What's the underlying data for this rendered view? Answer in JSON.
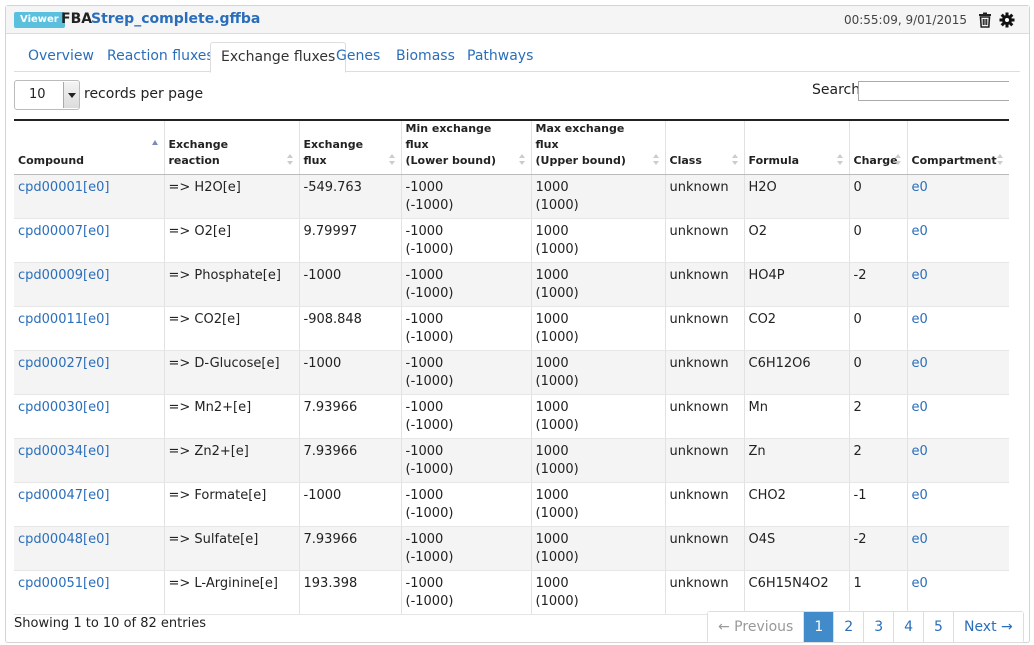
{
  "header": {
    "badge": "Viewer",
    "object_type": "FBA",
    "object_name": "Strep_complete.gffba",
    "timestamp": "00:55:09, 9/01/2015"
  },
  "icons": {
    "trash": "trash-icon",
    "settings": "gear-icon"
  },
  "tabs": [
    {
      "label": "Overview"
    },
    {
      "label": "Reaction fluxes"
    },
    {
      "label": "Exchange fluxes",
      "active": true
    },
    {
      "label": "Genes"
    },
    {
      "label": "Biomass"
    },
    {
      "label": "Pathways"
    }
  ],
  "length_select": {
    "value": "10",
    "label": "records per page"
  },
  "search": {
    "label": "Search:",
    "value": ""
  },
  "table": {
    "columns": [
      {
        "line1": "Compound",
        "line2": ""
      },
      {
        "line1": "Exchange reaction",
        "line2": ""
      },
      {
        "line1": "Exchange flux",
        "line2": ""
      },
      {
        "line1": "Min exchange flux",
        "line2": "(Lower bound)"
      },
      {
        "line1": "Max exchange flux",
        "line2": "(Upper bound)"
      },
      {
        "line1": "Class",
        "line2": ""
      },
      {
        "line1": "Formula",
        "line2": ""
      },
      {
        "line1": "Charge",
        "line2": ""
      },
      {
        "line1": "Compartment",
        "line2": ""
      }
    ],
    "rows": [
      {
        "compound": "cpd00001[e0]",
        "reaction": "=> H2O[e]",
        "flux": "-549.763",
        "min1": "-1000",
        "min2": "(-1000)",
        "max1": "1000",
        "max2": "(1000)",
        "class": "unknown",
        "formula": "H2O",
        "charge": "0",
        "compartment": "e0"
      },
      {
        "compound": "cpd00007[e0]",
        "reaction": "=> O2[e]",
        "flux": "9.79997",
        "min1": "-1000",
        "min2": "(-1000)",
        "max1": "1000",
        "max2": "(1000)",
        "class": "unknown",
        "formula": "O2",
        "charge": "0",
        "compartment": "e0"
      },
      {
        "compound": "cpd00009[e0]",
        "reaction": "=> Phosphate[e]",
        "flux": "-1000",
        "min1": "-1000",
        "min2": "(-1000)",
        "max1": "1000",
        "max2": "(1000)",
        "class": "unknown",
        "formula": "HO4P",
        "charge": "-2",
        "compartment": "e0"
      },
      {
        "compound": "cpd00011[e0]",
        "reaction": "=> CO2[e]",
        "flux": "-908.848",
        "min1": "-1000",
        "min2": "(-1000)",
        "max1": "1000",
        "max2": "(1000)",
        "class": "unknown",
        "formula": "CO2",
        "charge": "0",
        "compartment": "e0"
      },
      {
        "compound": "cpd00027[e0]",
        "reaction": "=> D-Glucose[e]",
        "flux": "-1000",
        "min1": "-1000",
        "min2": "(-1000)",
        "max1": "1000",
        "max2": "(1000)",
        "class": "unknown",
        "formula": "C6H12O6",
        "charge": "0",
        "compartment": "e0"
      },
      {
        "compound": "cpd00030[e0]",
        "reaction": "=> Mn2+[e]",
        "flux": "7.93966",
        "min1": "-1000",
        "min2": "(-1000)",
        "max1": "1000",
        "max2": "(1000)",
        "class": "unknown",
        "formula": "Mn",
        "charge": "2",
        "compartment": "e0"
      },
      {
        "compound": "cpd00034[e0]",
        "reaction": "=> Zn2+[e]",
        "flux": "7.93966",
        "min1": "-1000",
        "min2": "(-1000)",
        "max1": "1000",
        "max2": "(1000)",
        "class": "unknown",
        "formula": "Zn",
        "charge": "2",
        "compartment": "e0"
      },
      {
        "compound": "cpd00047[e0]",
        "reaction": "=> Formate[e]",
        "flux": "-1000",
        "min1": "-1000",
        "min2": "(-1000)",
        "max1": "1000",
        "max2": "(1000)",
        "class": "unknown",
        "formula": "CHO2",
        "charge": "-1",
        "compartment": "e0"
      },
      {
        "compound": "cpd00048[e0]",
        "reaction": "=> Sulfate[e]",
        "flux": "7.93966",
        "min1": "-1000",
        "min2": "(-1000)",
        "max1": "1000",
        "max2": "(1000)",
        "class": "unknown",
        "formula": "O4S",
        "charge": "-2",
        "compartment": "e0"
      },
      {
        "compound": "cpd00051[e0]",
        "reaction": "=> L-Arginine[e]",
        "flux": "193.398",
        "min1": "-1000",
        "min2": "(-1000)",
        "max1": "1000",
        "max2": "(1000)",
        "class": "unknown",
        "formula": "C6H15N4O2",
        "charge": "1",
        "compartment": "e0"
      }
    ]
  },
  "info": "Showing 1 to 10 of 82 entries",
  "pagination": {
    "previous": "← Previous",
    "pages": [
      "1",
      "2",
      "3",
      "4",
      "5"
    ],
    "current": "1",
    "next": "Next →"
  },
  "colors": {
    "link": "#2a6ebb",
    "badge": "#5bc0de",
    "active_page": "#428bca"
  }
}
